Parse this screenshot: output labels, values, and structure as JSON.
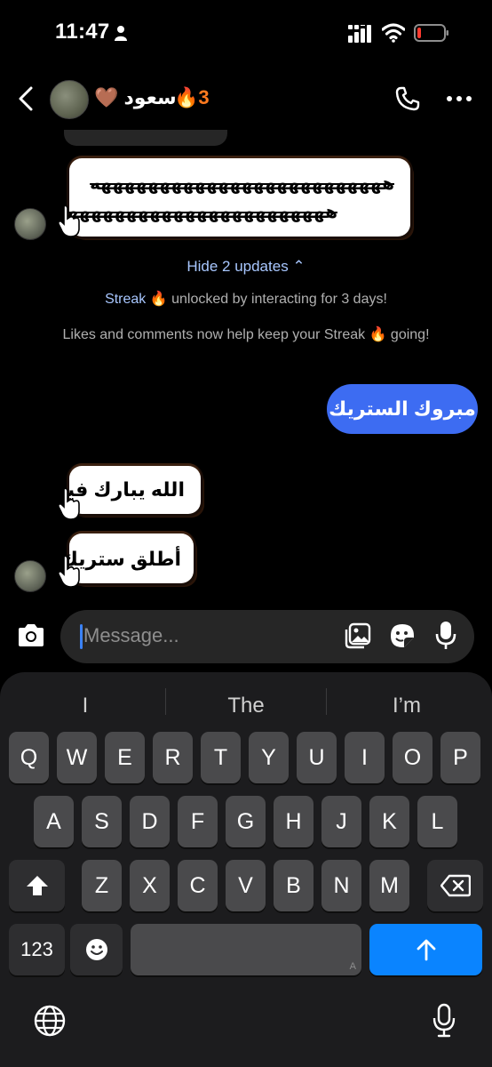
{
  "status_bar": {
    "time": "11:47"
  },
  "header": {
    "contact_name": "سعود 🤎",
    "streak_count": "🔥3"
  },
  "chat": {
    "sticker_struck_line1": "هههههههههههههههههههههههههه",
    "sticker_struck_line2": "هههههههههههههههههههههههه",
    "hide_updates": "Hide 2 updates ⌃",
    "streak_link": "Streak 🔥",
    "streak_text": " unlocked by interacting for 3 days!",
    "likes_text": "Likes and comments now help keep your Streak 🔥 going!",
    "outgoing_message": "مبروك الستريك",
    "incoming_sticker_1": "الله يبارك فيك",
    "incoming_sticker_2": "أطلق ستريك"
  },
  "composer": {
    "placeholder": "Message..."
  },
  "keyboard": {
    "suggestions": [
      "I",
      "The",
      "I’m"
    ],
    "row1": [
      "Q",
      "W",
      "E",
      "R",
      "T",
      "Y",
      "U",
      "I",
      "O",
      "P"
    ],
    "row2": [
      "A",
      "S",
      "D",
      "F",
      "G",
      "H",
      "J",
      "K",
      "L"
    ],
    "row3": [
      "Z",
      "X",
      "C",
      "V",
      "B",
      "N",
      "M"
    ],
    "numbers_key": "123",
    "space_hint": "A"
  },
  "icons": {
    "accent": "#3d6cf2",
    "streak_color": "#ff7a1f",
    "return_key": "#0a84ff"
  }
}
